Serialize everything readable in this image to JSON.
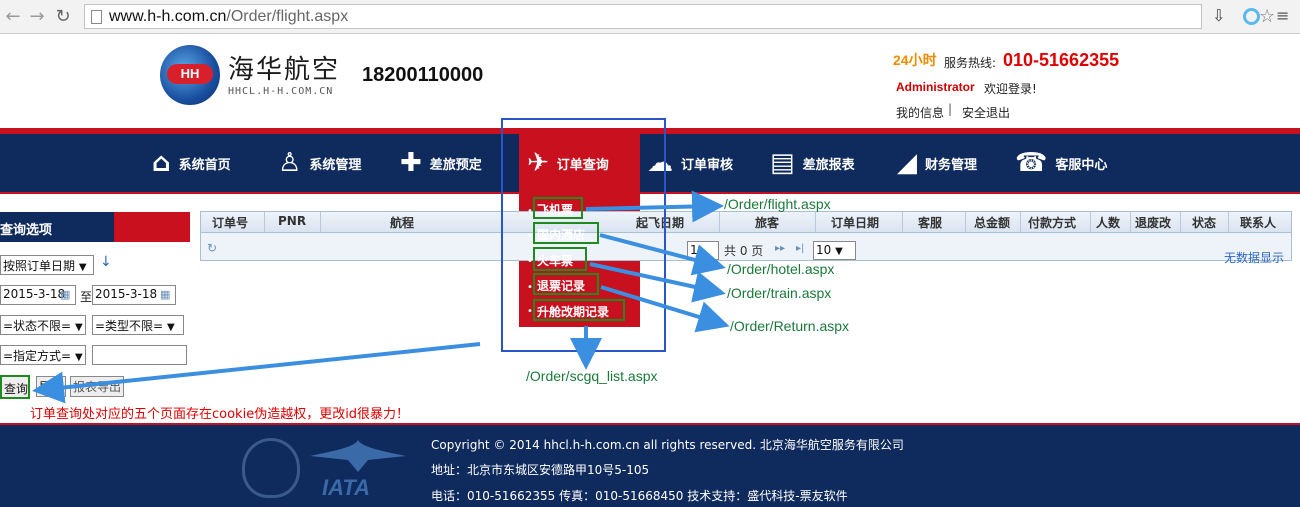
{
  "browser": {
    "url_host": "www.h-h.com.cn",
    "url_path": "/Order/flight.aspx"
  },
  "header": {
    "logo_badge": "HH",
    "logo_cn": "海华航空",
    "logo_en": "HHCL.H-H.COM.CN",
    "phone": "18200110000",
    "hotline_24": "24小时",
    "hotline_label": "服务热线:",
    "hotline_number": "010-51662355",
    "user_name": "Administrator",
    "welcome": "欢迎登录!",
    "my_info": "我的信息",
    "separator": "|",
    "logout": "安全退出"
  },
  "nav": {
    "items": [
      {
        "label": "系统首页",
        "icon": "home-icon"
      },
      {
        "label": "系统管理",
        "icon": "walker-icon"
      },
      {
        "label": "差旅预定",
        "icon": "puzzle-icon"
      },
      {
        "label": "订单查询",
        "icon": "plane-icon"
      },
      {
        "label": "订单审核",
        "icon": "cloud-icon"
      },
      {
        "label": "差旅报表",
        "icon": "table-icon"
      },
      {
        "label": "财务管理",
        "icon": "stairs-icon"
      },
      {
        "label": "客服中心",
        "icon": "phone-icon"
      }
    ]
  },
  "dropdown": {
    "items": [
      "飞机票",
      "国内酒店",
      "火车票",
      "退票记录",
      "升舱改期记录"
    ]
  },
  "annotations": {
    "flight": "/Order/flight.aspx",
    "hotel": "/Order/hotel.aspx",
    "train": "/Order/train.aspx",
    "return": "/Order/Return.aspx",
    "scgq": "/Order/scgq_list.aspx",
    "note": "订单查询处对应的五个页面存在cookie伪造越权，更改id很暴力！"
  },
  "query_panel": {
    "title": "查询选项",
    "date_mode": "按照订单日期",
    "date_from": "2015-3-18",
    "date_to_label": "至",
    "date_to": "2015-3-18",
    "status_select": "=状态不限=",
    "type_select": "=类型不限=",
    "method_select": "=指定方式=",
    "search_value": "",
    "query_button": "查询",
    "export_button": "导出",
    "export2_button": "报表导出"
  },
  "table": {
    "headers": [
      "订单号",
      "PNR",
      "航程",
      "起飞日期",
      "旅客",
      "订单日期",
      "客服",
      "总金额",
      "付款方式",
      "人数",
      "退废改",
      "状态",
      "联系人"
    ],
    "pager_page": "1",
    "pager_total": "共 0 页",
    "page_size": "10",
    "empty_text": "无数据显示"
  },
  "footer": {
    "copyright": "Copyright © 2014 hhcl.h-h.com.cn all rights reserved. 北京海华航空服务有限公司",
    "address": "地址：北京市东城区安德路甲10号5-105",
    "contact": "电话：010-51662355 传真：010-51668450  技术支持：盛代科技-票友软件",
    "iata": "IATA"
  }
}
